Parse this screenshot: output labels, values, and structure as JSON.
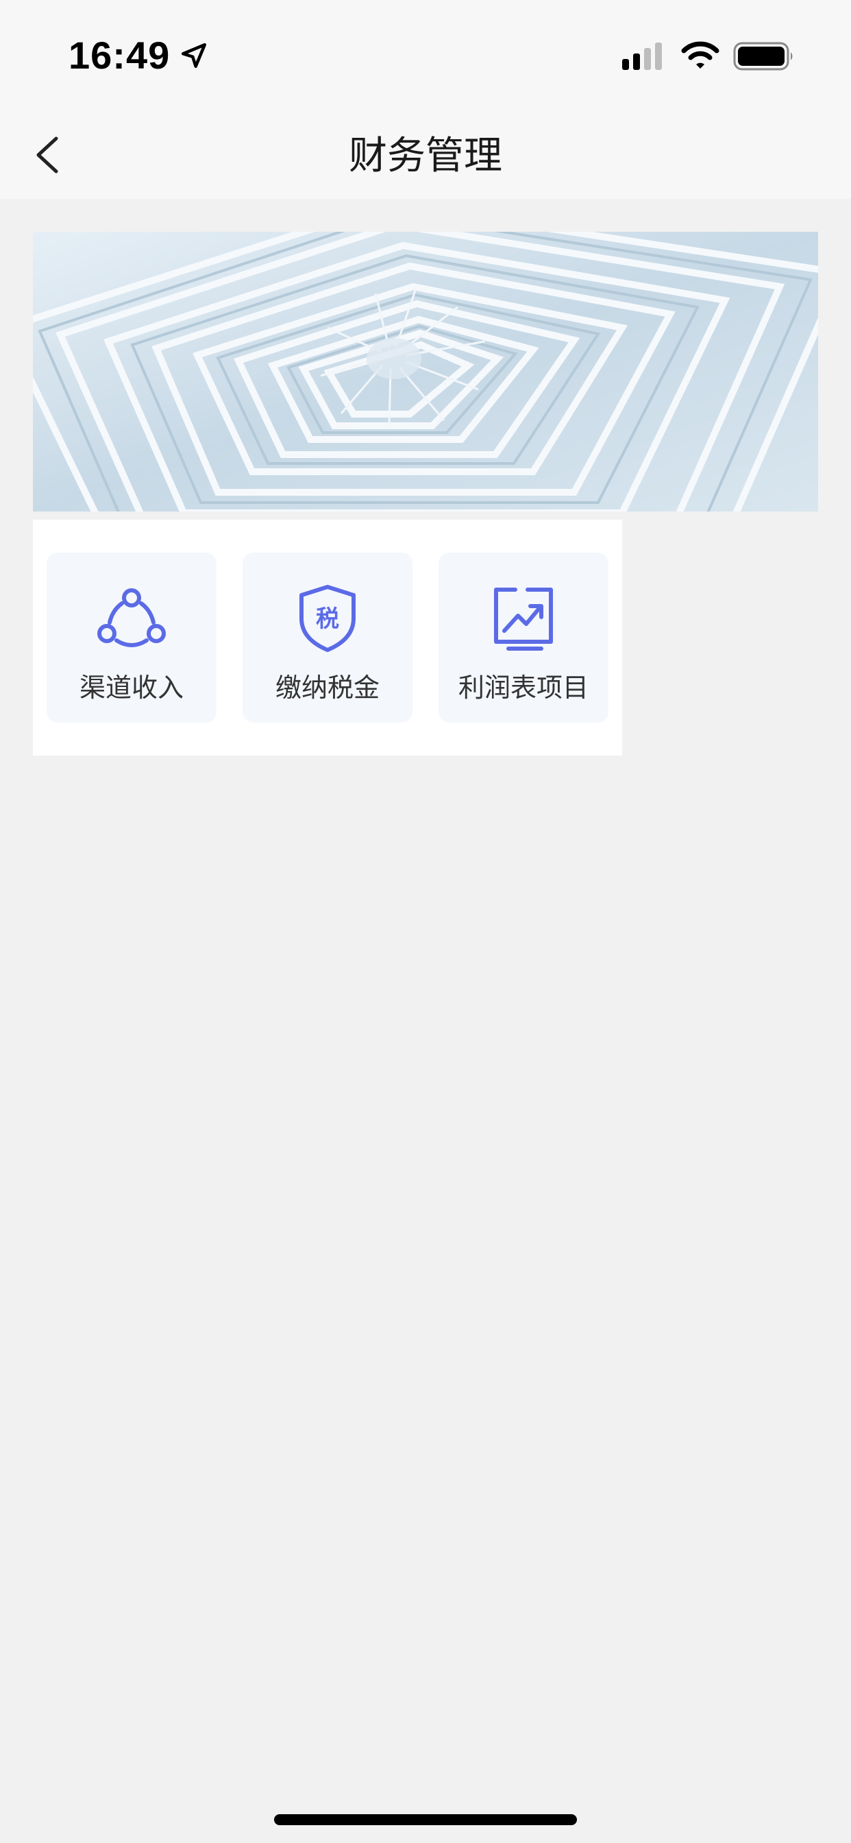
{
  "status_bar": {
    "time": "16:49",
    "icons": [
      "location-arrow-icon",
      "cellular-signal-icon",
      "wifi-icon",
      "battery-icon"
    ]
  },
  "nav": {
    "title": "财务管理",
    "back_icon": "chevron-left-icon"
  },
  "banner": {
    "image": "abstract-spiral-corridor"
  },
  "menu": {
    "items": [
      {
        "label": "渠道收入",
        "icon": "channel-nodes-icon"
      },
      {
        "label": "缴纳税金",
        "icon": "tax-shield-icon",
        "icon_text": "税"
      },
      {
        "label": "利润表项目",
        "icon": "trend-chart-icon"
      }
    ]
  },
  "colors": {
    "accent": "#5b6be6",
    "page_bg": "#f1f1f1",
    "bar_bg": "#f7f7f7",
    "tile_bg": "#f4f7fc"
  }
}
